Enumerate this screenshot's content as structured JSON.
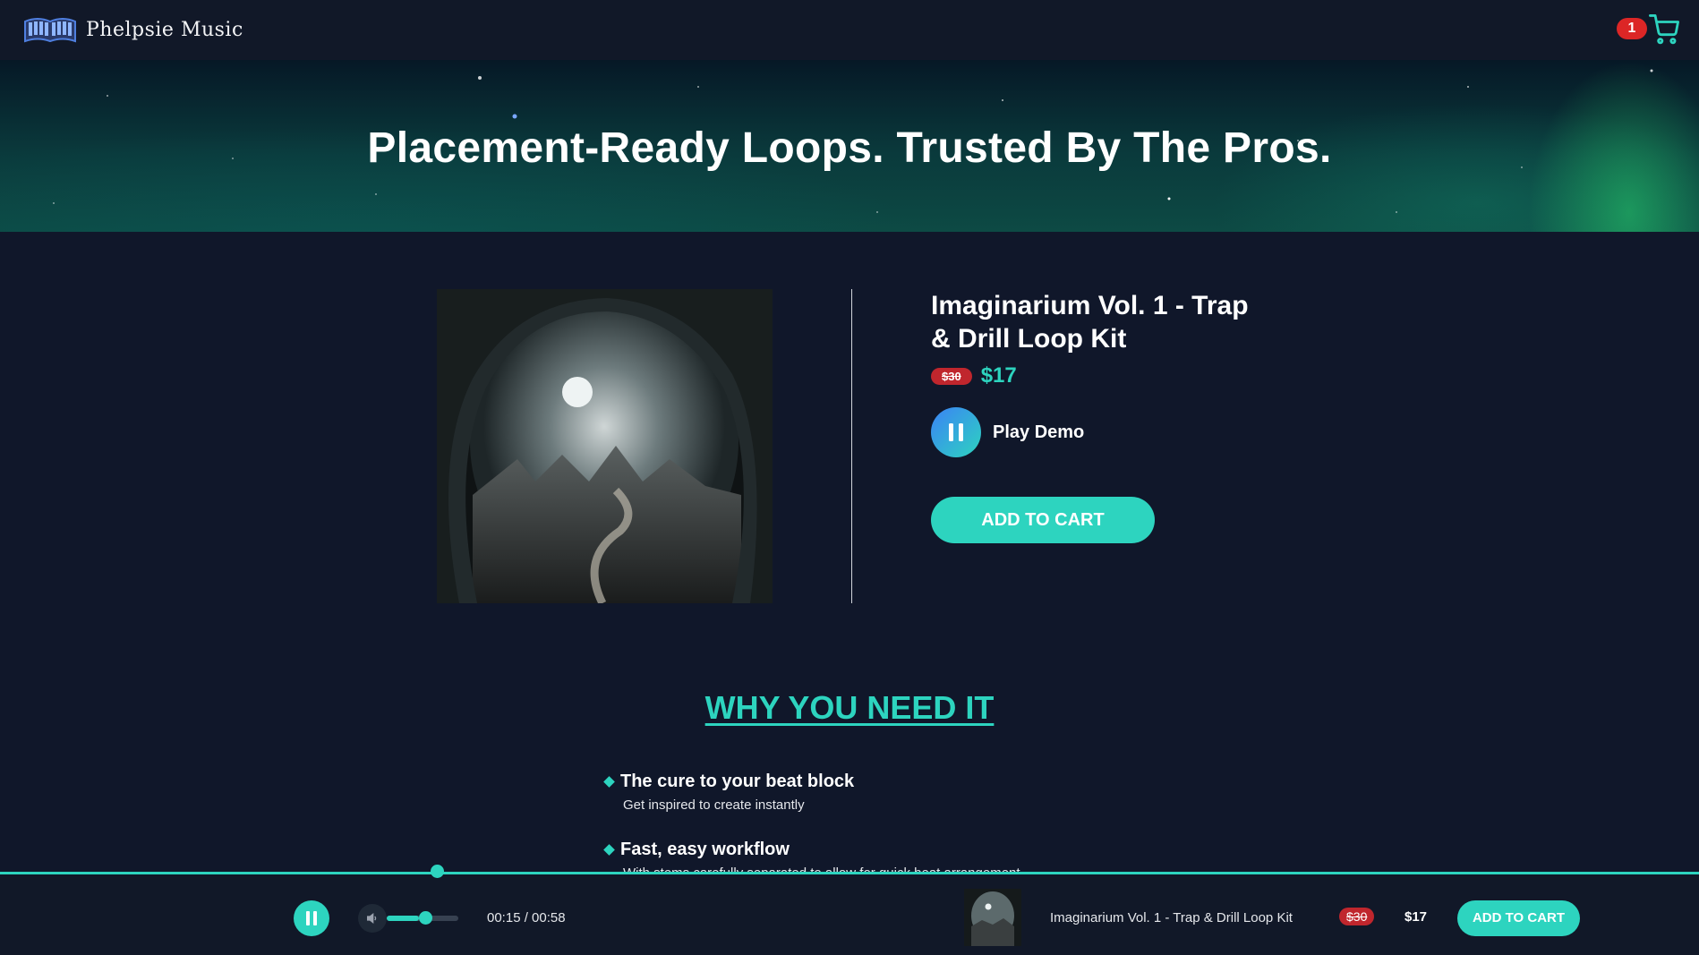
{
  "brand": {
    "name": "Phelpsie Music",
    "logo_icon": "piano-book-icon"
  },
  "cart": {
    "count": "1",
    "icon": "shopping-cart-icon"
  },
  "hero": {
    "title": "Placement-Ready Loops. Trusted By The Pros."
  },
  "product": {
    "title": "Imaginarium Vol. 1 - Trap & Drill Loop Kit",
    "old_price": "$30",
    "price": "$17",
    "demo_label": "Play Demo",
    "add_to_cart": "ADD TO CART"
  },
  "why": {
    "heading": "WHY YOU NEED IT",
    "features": [
      {
        "title": "The cure to your beat block",
        "desc": "Get inspired to create instantly"
      },
      {
        "title": "Fast, easy workflow",
        "desc": "With stems carefully separated to allow for quick beat arrangement"
      }
    ]
  },
  "player": {
    "time": "00:15 / 00:58",
    "progress": 0.26,
    "volume": 0.45,
    "title": "Imaginarium Vol. 1 - Trap & Drill Loop Kit",
    "old_price": "$30",
    "price": "$17",
    "add_to_cart": "ADD TO CART"
  },
  "colors": {
    "accent": "#2dd4bf",
    "background": "#10172a",
    "sale": "#c0262d",
    "badge": "#dc2626"
  }
}
